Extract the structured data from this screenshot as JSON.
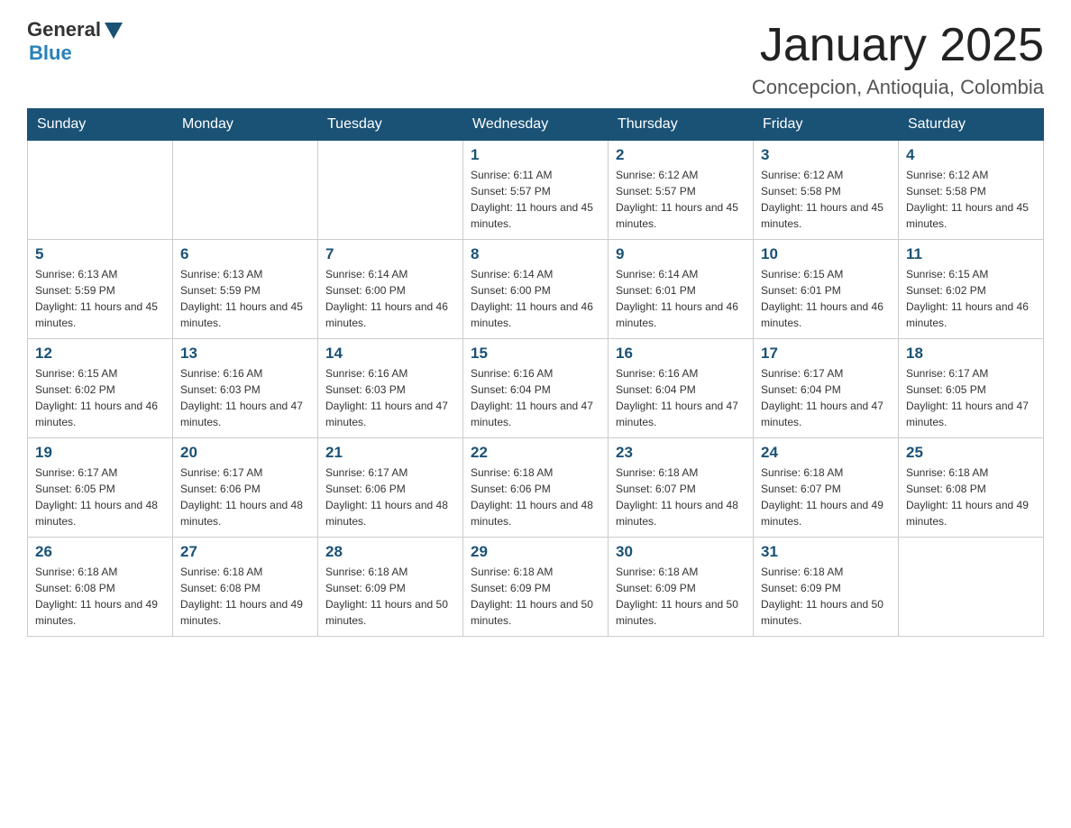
{
  "header": {
    "logo_general": "General",
    "logo_blue": "Blue",
    "month_title": "January 2025",
    "location": "Concepcion, Antioquia, Colombia"
  },
  "weekdays": [
    "Sunday",
    "Monday",
    "Tuesday",
    "Wednesday",
    "Thursday",
    "Friday",
    "Saturday"
  ],
  "weeks": [
    [
      {
        "day": "",
        "sunrise": "",
        "sunset": "",
        "daylight": ""
      },
      {
        "day": "",
        "sunrise": "",
        "sunset": "",
        "daylight": ""
      },
      {
        "day": "",
        "sunrise": "",
        "sunset": "",
        "daylight": ""
      },
      {
        "day": "1",
        "sunrise": "Sunrise: 6:11 AM",
        "sunset": "Sunset: 5:57 PM",
        "daylight": "Daylight: 11 hours and 45 minutes."
      },
      {
        "day": "2",
        "sunrise": "Sunrise: 6:12 AM",
        "sunset": "Sunset: 5:57 PM",
        "daylight": "Daylight: 11 hours and 45 minutes."
      },
      {
        "day": "3",
        "sunrise": "Sunrise: 6:12 AM",
        "sunset": "Sunset: 5:58 PM",
        "daylight": "Daylight: 11 hours and 45 minutes."
      },
      {
        "day": "4",
        "sunrise": "Sunrise: 6:12 AM",
        "sunset": "Sunset: 5:58 PM",
        "daylight": "Daylight: 11 hours and 45 minutes."
      }
    ],
    [
      {
        "day": "5",
        "sunrise": "Sunrise: 6:13 AM",
        "sunset": "Sunset: 5:59 PM",
        "daylight": "Daylight: 11 hours and 45 minutes."
      },
      {
        "day": "6",
        "sunrise": "Sunrise: 6:13 AM",
        "sunset": "Sunset: 5:59 PM",
        "daylight": "Daylight: 11 hours and 45 minutes."
      },
      {
        "day": "7",
        "sunrise": "Sunrise: 6:14 AM",
        "sunset": "Sunset: 6:00 PM",
        "daylight": "Daylight: 11 hours and 46 minutes."
      },
      {
        "day": "8",
        "sunrise": "Sunrise: 6:14 AM",
        "sunset": "Sunset: 6:00 PM",
        "daylight": "Daylight: 11 hours and 46 minutes."
      },
      {
        "day": "9",
        "sunrise": "Sunrise: 6:14 AM",
        "sunset": "Sunset: 6:01 PM",
        "daylight": "Daylight: 11 hours and 46 minutes."
      },
      {
        "day": "10",
        "sunrise": "Sunrise: 6:15 AM",
        "sunset": "Sunset: 6:01 PM",
        "daylight": "Daylight: 11 hours and 46 minutes."
      },
      {
        "day": "11",
        "sunrise": "Sunrise: 6:15 AM",
        "sunset": "Sunset: 6:02 PM",
        "daylight": "Daylight: 11 hours and 46 minutes."
      }
    ],
    [
      {
        "day": "12",
        "sunrise": "Sunrise: 6:15 AM",
        "sunset": "Sunset: 6:02 PM",
        "daylight": "Daylight: 11 hours and 46 minutes."
      },
      {
        "day": "13",
        "sunrise": "Sunrise: 6:16 AM",
        "sunset": "Sunset: 6:03 PM",
        "daylight": "Daylight: 11 hours and 47 minutes."
      },
      {
        "day": "14",
        "sunrise": "Sunrise: 6:16 AM",
        "sunset": "Sunset: 6:03 PM",
        "daylight": "Daylight: 11 hours and 47 minutes."
      },
      {
        "day": "15",
        "sunrise": "Sunrise: 6:16 AM",
        "sunset": "Sunset: 6:04 PM",
        "daylight": "Daylight: 11 hours and 47 minutes."
      },
      {
        "day": "16",
        "sunrise": "Sunrise: 6:16 AM",
        "sunset": "Sunset: 6:04 PM",
        "daylight": "Daylight: 11 hours and 47 minutes."
      },
      {
        "day": "17",
        "sunrise": "Sunrise: 6:17 AM",
        "sunset": "Sunset: 6:04 PM",
        "daylight": "Daylight: 11 hours and 47 minutes."
      },
      {
        "day": "18",
        "sunrise": "Sunrise: 6:17 AM",
        "sunset": "Sunset: 6:05 PM",
        "daylight": "Daylight: 11 hours and 47 minutes."
      }
    ],
    [
      {
        "day": "19",
        "sunrise": "Sunrise: 6:17 AM",
        "sunset": "Sunset: 6:05 PM",
        "daylight": "Daylight: 11 hours and 48 minutes."
      },
      {
        "day": "20",
        "sunrise": "Sunrise: 6:17 AM",
        "sunset": "Sunset: 6:06 PM",
        "daylight": "Daylight: 11 hours and 48 minutes."
      },
      {
        "day": "21",
        "sunrise": "Sunrise: 6:17 AM",
        "sunset": "Sunset: 6:06 PM",
        "daylight": "Daylight: 11 hours and 48 minutes."
      },
      {
        "day": "22",
        "sunrise": "Sunrise: 6:18 AM",
        "sunset": "Sunset: 6:06 PM",
        "daylight": "Daylight: 11 hours and 48 minutes."
      },
      {
        "day": "23",
        "sunrise": "Sunrise: 6:18 AM",
        "sunset": "Sunset: 6:07 PM",
        "daylight": "Daylight: 11 hours and 48 minutes."
      },
      {
        "day": "24",
        "sunrise": "Sunrise: 6:18 AM",
        "sunset": "Sunset: 6:07 PM",
        "daylight": "Daylight: 11 hours and 49 minutes."
      },
      {
        "day": "25",
        "sunrise": "Sunrise: 6:18 AM",
        "sunset": "Sunset: 6:08 PM",
        "daylight": "Daylight: 11 hours and 49 minutes."
      }
    ],
    [
      {
        "day": "26",
        "sunrise": "Sunrise: 6:18 AM",
        "sunset": "Sunset: 6:08 PM",
        "daylight": "Daylight: 11 hours and 49 minutes."
      },
      {
        "day": "27",
        "sunrise": "Sunrise: 6:18 AM",
        "sunset": "Sunset: 6:08 PM",
        "daylight": "Daylight: 11 hours and 49 minutes."
      },
      {
        "day": "28",
        "sunrise": "Sunrise: 6:18 AM",
        "sunset": "Sunset: 6:09 PM",
        "daylight": "Daylight: 11 hours and 50 minutes."
      },
      {
        "day": "29",
        "sunrise": "Sunrise: 6:18 AM",
        "sunset": "Sunset: 6:09 PM",
        "daylight": "Daylight: 11 hours and 50 minutes."
      },
      {
        "day": "30",
        "sunrise": "Sunrise: 6:18 AM",
        "sunset": "Sunset: 6:09 PM",
        "daylight": "Daylight: 11 hours and 50 minutes."
      },
      {
        "day": "31",
        "sunrise": "Sunrise: 6:18 AM",
        "sunset": "Sunset: 6:09 PM",
        "daylight": "Daylight: 11 hours and 50 minutes."
      },
      {
        "day": "",
        "sunrise": "",
        "sunset": "",
        "daylight": ""
      }
    ]
  ]
}
